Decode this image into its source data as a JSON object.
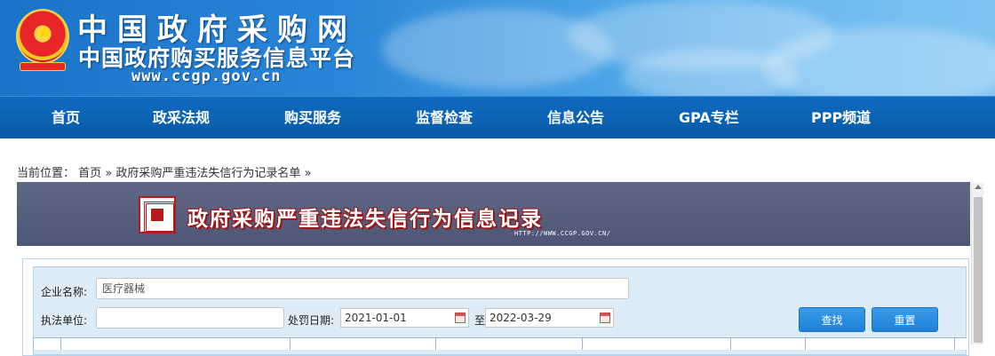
{
  "header": {
    "title": "中国政府采购网",
    "subtitle": "中国政府购买服务信息平台",
    "url": "www.ccgp.gov.cn"
  },
  "nav": {
    "items": [
      {
        "label": "首页"
      },
      {
        "label": "政采法规"
      },
      {
        "label": "购买服务"
      },
      {
        "label": "监督检查"
      },
      {
        "label": "信息公告"
      },
      {
        "label": "GPA专栏"
      },
      {
        "label": "PPP频道"
      }
    ]
  },
  "breadcrumb": {
    "prefix": "当前位置：",
    "home": "首页",
    "separator1": "»",
    "current": "政府采购严重违法失信行为记录名单",
    "separator2": "»"
  },
  "banner": {
    "title": "政府采购严重违法失信行为信息记录",
    "url": "HTTP://WWW.CCGP.GOV.CN/"
  },
  "search": {
    "company_label": "企业名称:",
    "company_value": "医疗器械",
    "agency_label": "执法单位:",
    "agency_value": "",
    "date_label": "处罚日期:",
    "date_from": "2021-01-01",
    "date_to_label": "至",
    "date_to": "2022-03-29",
    "search_button": "查找",
    "reset_button": "重置"
  },
  "colors": {
    "nav_bg": "#0a5aa8",
    "banner_bg": "#565f7e",
    "panel_bg": "#dcebf6",
    "button_bg": "#1f80d6",
    "banner_title_shadow": "#9a1515"
  }
}
